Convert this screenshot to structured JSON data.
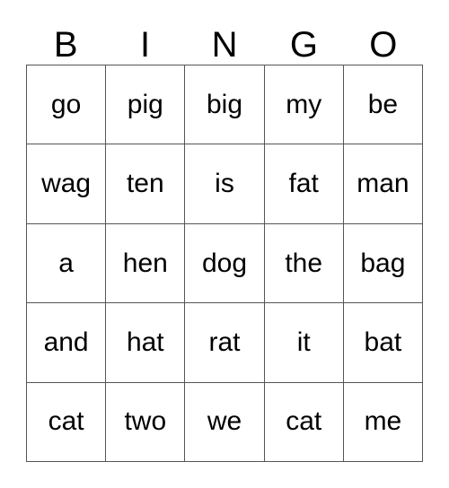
{
  "card": {
    "title": "BINGO",
    "header": {
      "letters": [
        "B",
        "I",
        "N",
        "G",
        "O"
      ]
    },
    "colors": {
      "background": "#ffffff",
      "border": "#555555",
      "text": "#000000"
    },
    "grid": {
      "columns": 5,
      "rows": 5,
      "cells": [
        [
          {
            "word": "go"
          },
          {
            "word": "pig"
          },
          {
            "word": "big"
          },
          {
            "word": "my"
          },
          {
            "word": "be"
          }
        ],
        [
          {
            "word": "wag"
          },
          {
            "word": "ten"
          },
          {
            "word": "is"
          },
          {
            "word": "fat"
          },
          {
            "word": "man"
          }
        ],
        [
          {
            "word": "a"
          },
          {
            "word": "hen"
          },
          {
            "word": "dog"
          },
          {
            "word": "the"
          },
          {
            "word": "bag"
          }
        ],
        [
          {
            "word": "and"
          },
          {
            "word": "hat"
          },
          {
            "word": "rat"
          },
          {
            "word": "it"
          },
          {
            "word": "bat"
          }
        ],
        [
          {
            "word": "cat"
          },
          {
            "word": "two"
          },
          {
            "word": "we"
          },
          {
            "word": "cat"
          },
          {
            "word": "me"
          }
        ]
      ]
    }
  }
}
